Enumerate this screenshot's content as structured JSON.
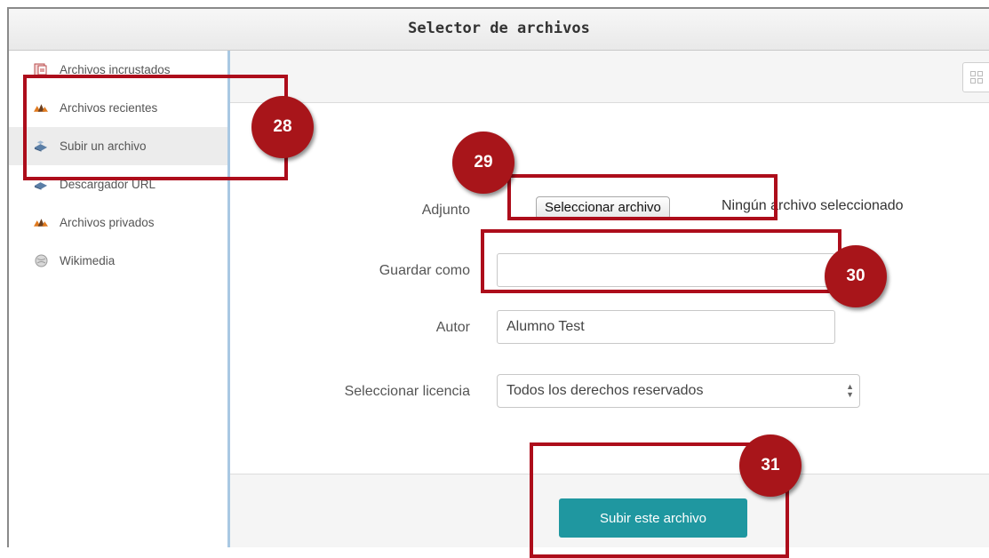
{
  "window": {
    "title": "Selector de archivos"
  },
  "sidebar": {
    "items": [
      {
        "label": "Archivos incrustados",
        "icon": "embedded-files-icon"
      },
      {
        "label": "Archivos recientes",
        "icon": "recent-files-icon"
      },
      {
        "label": "Subir un archivo",
        "icon": "upload-icon",
        "selected": true
      },
      {
        "label": "Descargador URL",
        "icon": "url-download-icon"
      },
      {
        "label": "Archivos privados",
        "icon": "private-files-icon"
      },
      {
        "label": "Wikimedia",
        "icon": "wikimedia-icon"
      }
    ]
  },
  "toolbar": {
    "view_icon": "grid-view-icon"
  },
  "form": {
    "attachment": {
      "label": "Adjunto",
      "button": "Seleccionar archivo",
      "status": "Ningún archivo seleccionado"
    },
    "save_as": {
      "label": "Guardar como",
      "value": ""
    },
    "author": {
      "label": "Autor",
      "value": "Alumno Test"
    },
    "license": {
      "label": "Seleccionar licencia",
      "value": "Todos los derechos reservados"
    }
  },
  "footer": {
    "upload_button": "Subir este archivo"
  },
  "annotations": {
    "badges": [
      "28",
      "29",
      "30",
      "31"
    ],
    "color": "#a8151a"
  },
  "colors": {
    "accent": "#1f97a0",
    "annotation": "#ad0d1b"
  }
}
